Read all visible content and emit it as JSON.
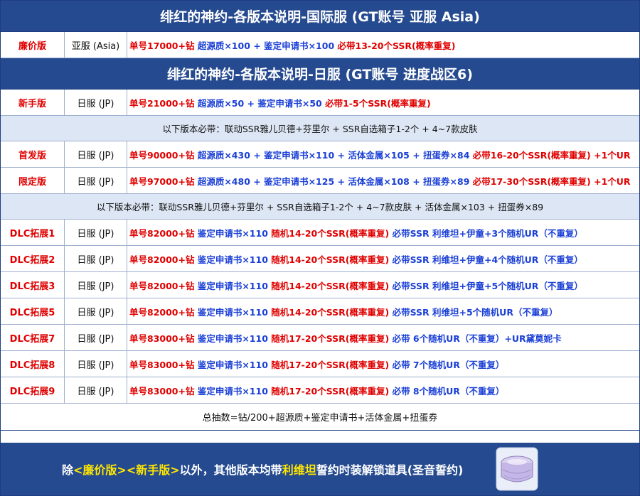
{
  "banner_intl": "绯红的神约-各版本说明-国际服 (GT账号 亚服 Asia)",
  "banner_jp": "绯红的神约-各版本说明-日服 (GT账号 进度战区6)",
  "intl_rows": [
    {
      "name": "廉价版",
      "server": "亚服 (Asia)",
      "parts": [
        {
          "text": "单号17000+钻 ",
          "color": "red"
        },
        {
          "text": "超源质×100 + 鉴定申请书×100 ",
          "color": "blue"
        },
        {
          "text": "必带13-20个SSR(概率重复)",
          "color": "red"
        }
      ]
    }
  ],
  "newbie_row": {
    "name": "新手版",
    "server": "日服 (JP)",
    "parts": [
      {
        "text": "单号21000+钻 ",
        "color": "red"
      },
      {
        "text": "超源质×50 + 鉴定申请书×50 ",
        "color": "blue"
      },
      {
        "text": "必带1-5个SSR(概率重复)",
        "color": "red"
      }
    ]
  },
  "note1": "以下版本必带：联动SSR雅儿贝德+芬里尔 + SSR自选箱子1-2个 + 4~7款皮肤",
  "premium_rows": [
    {
      "name": "首发版",
      "server": "日服 (JP)",
      "parts": [
        {
          "text": "单号90000+钻 ",
          "color": "red"
        },
        {
          "text": "超源质×430 + 鉴定申请书×110 + 活体金属×105 + 扭蛋券×84 ",
          "color": "blue"
        },
        {
          "text": "必带16-20个SSR(概率重复) +1个UR",
          "color": "red"
        }
      ]
    },
    {
      "name": "限定版",
      "server": "日服 (JP)",
      "parts": [
        {
          "text": "单号97000+钻 ",
          "color": "red"
        },
        {
          "text": "超源质×480 + 鉴定申请书×125 + 活体金属×108 + 扭蛋券×89 ",
          "color": "blue"
        },
        {
          "text": "必带17-30个SSR(概率重复) +1个UR",
          "color": "red"
        }
      ]
    }
  ],
  "note2": "以下版本必带：联动SSR雅儿贝德+芬里尔 + SSR自选箱子1-2个 + 4~7款皮肤 + 活体金属×103 + 扭蛋券×89",
  "dlc_rows": [
    {
      "name": "DLC拓展1",
      "server": "日服 (JP)",
      "parts": [
        {
          "text": "单号82000+钻 ",
          "color": "red"
        },
        {
          "text": "鉴定申请书×110 ",
          "color": "blue"
        },
        {
          "text": "随机14-20个SSR(概率重复) ",
          "color": "red"
        },
        {
          "text": "必带SSR 利维坦+伊童+3个随机UR（不重复）",
          "color": "blue"
        }
      ]
    },
    {
      "name": "DLC拓展2",
      "server": "日服 (JP)",
      "parts": [
        {
          "text": "单号82000+钻 ",
          "color": "red"
        },
        {
          "text": "鉴定申请书×110 ",
          "color": "blue"
        },
        {
          "text": "随机14-20个SSR(概率重复) ",
          "color": "red"
        },
        {
          "text": "必带SSR 利维坦+伊童+4个随机UR（不重复）",
          "color": "blue"
        }
      ]
    },
    {
      "name": "DLC拓展3",
      "server": "日服 (JP)",
      "parts": [
        {
          "text": "单号82000+钻 ",
          "color": "red"
        },
        {
          "text": "鉴定申请书×110 ",
          "color": "blue"
        },
        {
          "text": "随机14-20个SSR(概率重复) ",
          "color": "red"
        },
        {
          "text": "必带SSR 利维坦+伊童+5个随机UR（不重复）",
          "color": "blue"
        }
      ]
    },
    {
      "name": "DLC拓展5",
      "server": "日服 (JP)",
      "parts": [
        {
          "text": "单号82000+钻 ",
          "color": "red"
        },
        {
          "text": "鉴定申请书×110 ",
          "color": "blue"
        },
        {
          "text": "随机14-20个SSR(概率重复) ",
          "color": "red"
        },
        {
          "text": "必带SSR 利维坦+5个随机UR（不重复）",
          "color": "blue"
        }
      ]
    },
    {
      "name": "DLC拓展7",
      "server": "日服 (JP)",
      "parts": [
        {
          "text": "单号83000+钻 ",
          "color": "red"
        },
        {
          "text": "鉴定申请书×110 ",
          "color": "blue"
        },
        {
          "text": "随机17-20个SSR(概率重复) ",
          "color": "red"
        },
        {
          "text": "必带 6个随机UR（不重复）+UR黛莫妮卡",
          "color": "blue"
        }
      ]
    },
    {
      "name": "DLC拓展8",
      "server": "日服 (JP)",
      "parts": [
        {
          "text": "单号83000+钻 ",
          "color": "red"
        },
        {
          "text": "鉴定申请书×110 ",
          "color": "blue"
        },
        {
          "text": "随机17-20个SSR(概率重复) ",
          "color": "red"
        },
        {
          "text": "必带 7个随机UR（不重复）",
          "color": "blue"
        }
      ]
    },
    {
      "name": "DLC拓展9",
      "server": "日服 (JP)",
      "parts": [
        {
          "text": "单号83000+钻 ",
          "color": "red"
        },
        {
          "text": "鉴定申请书×110 ",
          "color": "blue"
        },
        {
          "text": "随机17-20个SSR(概率重复) ",
          "color": "red"
        },
        {
          "text": "必带 8个随机UR（不重复）",
          "color": "blue"
        }
      ]
    }
  ],
  "total": "总抽数=钻/200+超源质+鉴定申请书+活体金属+扭蛋券",
  "footer": {
    "prefix": "除",
    "tag1": "<廉价版>",
    "tag2": "<新手版>",
    "middle": "以外，其他版本均带",
    "highlight": "利维坦",
    "suffix": "誓约时装解锁道具(圣音誓约)"
  },
  "colors": {
    "banner": "#254a8f",
    "red": "#e00000",
    "blue": "#1a3fd6",
    "note_bg": "#dde6f4",
    "highlight": "#ffe600"
  },
  "icons": {
    "footer_item": "purple-pillow-item-icon"
  }
}
